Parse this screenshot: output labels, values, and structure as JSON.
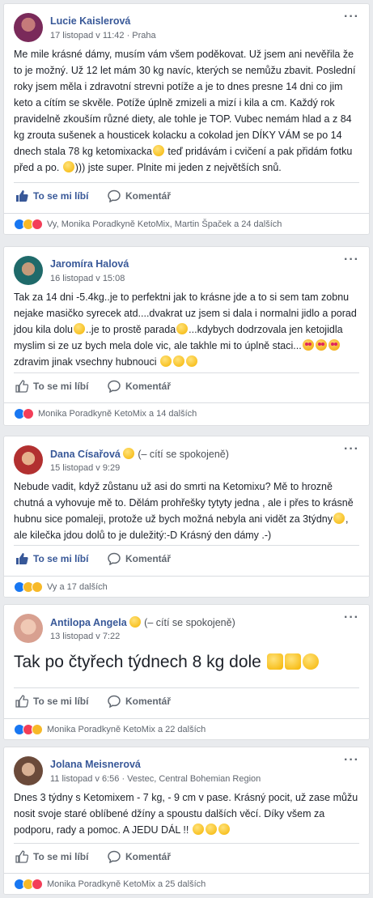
{
  "actions": {
    "like": "To se mi líbí",
    "comment": "Komentář"
  },
  "posts": [
    {
      "author": "Lucie Kaislerová",
      "feeling": "",
      "meta": "17 listopad v 11:42 · Praha",
      "text": "Me mile krásné dámy, musím vám všem poděkovat. Už jsem ani nevěřila že to je možný. Už 12 let mám 30 kg navíc, kterých se nemůžu zbavit. Poslední roky jsem měla i zdravotní strevni potíže a je to dnes presne 14 dni co jim keto a cítím se skvěle. Potíže úplně zmizeli a mizí i kila a cm. Každý rok pravidelně zkouším různé diety, ale tohle je TOP. Vubec nemám hlad a z 84 kg zrouta sušenek a housticek kolacku a cokolad jen DÍKY VÁM se po 14 dnech stala 78 kg ketomixacka",
      "text2": " teď pridávám i cvičení a pak přidám fotku před a po. ",
      "text3": "))) jste super. Plnite mi jeden z největších snů.",
      "reactions": "Vy, Monika Poradkyně KetoMix, Martin Špaček a 24 dalších",
      "liked": true
    },
    {
      "author": "Jaromíra Halová",
      "feeling": "",
      "meta": "16 listopad v 15:08",
      "text": "Tak za 14 dni -5.4kg..je to perfektni jak to krásne jde a to si sem tam zobnu nejake masičko syrecek atd....dvakrat uz jsem si dala i normalni jidlo a porad jdou kila dolu",
      "text2": "..je to prostě parada",
      "text3": "...kdybych dodrzovala jen ketojidla myslim si ze uz bych mela dole vic, ale takhle mi to úplně staci...",
      "text4": " zdravim jinak vsechny hubnouci ",
      "reactions": "Monika Poradkyně KetoMix a 14 dalších",
      "liked": false
    },
    {
      "author": "Dana Císařová",
      "feeling": "(– cítí se spokojeně)",
      "meta": "15 listopad v 9:29",
      "text": "Nebude vadit, když zůstanu už asi do smrti na Ketomixu? Mě to hrozně chutná a vyhovuje mě to. Dělám prohřešky tytyty jedna , ale i přes to krásně hubnu sice pomaleji, protože už bych možná nebyla ani vidět za 3týdny",
      "text2": ", ale kilečka jdou dolů to je duležitý:-D Krásný den dámy .-)",
      "reactions": "Vy a 17 dalších",
      "liked": true
    },
    {
      "author": "Antilopa Angela",
      "feeling": "(– cítí se spokojeně)",
      "meta": "13 listopad v 7:22",
      "text": "Tak po čtyřech týdnech 8 kg dole",
      "reactions": "Monika Poradkyně KetoMix a 22 dalších",
      "liked": false
    },
    {
      "author": "Jolana Meisnerová",
      "feeling": "",
      "meta": "11 listopad v 6:56 · Vestec, Central Bohemian Region",
      "text": "Dnes 3 týdny s Ketomixem - 7 kg, - 9 cm v pase. Krásný pocit, už zase můžu nosit svoje staré oblíbené džíny a spoustu dalších věcí. Díky všem za podporu, rady a pomoc. A JEDU DÁL !!",
      "reactions": "Monika Poradkyně KetoMix a 25 dalších",
      "liked": false
    }
  ]
}
